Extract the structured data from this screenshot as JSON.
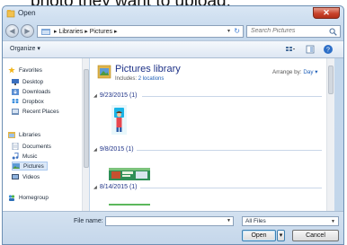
{
  "caption": {
    "text": "photo they want to upload."
  },
  "window": {
    "title": "Open",
    "close_glyph": "✕"
  },
  "address": {
    "back_glyph": "◀",
    "forward_glyph": "▶",
    "path": "▸ Libraries ▸ Pictures ▸",
    "dropdown_glyph": "▾",
    "refresh_glyph": "↻"
  },
  "search": {
    "placeholder": "Search Pictures"
  },
  "toolbar": {
    "organize_label": "Organize ▾"
  },
  "sidebar": {
    "favorites_label": "Favorites",
    "favorites": [
      {
        "label": "Desktop",
        "icon": "desktop-icon"
      },
      {
        "label": "Downloads",
        "icon": "downloads-icon"
      },
      {
        "label": "Dropbox",
        "icon": "dropbox-icon"
      },
      {
        "label": "Recent Places",
        "icon": "recent-places-icon"
      }
    ],
    "libraries_label": "Libraries",
    "libraries": [
      {
        "label": "Documents",
        "icon": "documents-icon"
      },
      {
        "label": "Music",
        "icon": "music-icon"
      },
      {
        "label": "Pictures",
        "icon": "pictures-icon",
        "selected": true
      },
      {
        "label": "Videos",
        "icon": "videos-icon"
      }
    ],
    "homegroup_label": "Homegroup"
  },
  "library": {
    "title": "Pictures library",
    "includes_label": "Includes:",
    "includes_value": "2 locations",
    "arrange_label": "Arrange by:",
    "arrange_value": "Day ▾"
  },
  "groups": [
    {
      "label": "9/23/2015 (1)"
    },
    {
      "label": "9/8/2015 (1)"
    },
    {
      "label": "8/14/2015 (1)"
    }
  ],
  "footer": {
    "filename_label": "File name:",
    "filename_value": "",
    "filetype_value": "All Files",
    "open_label": "Open",
    "split_glyph": "▾",
    "cancel_label": "Cancel"
  },
  "colors": {
    "link_blue": "#1e3287",
    "accent_blue": "#1e5fb8",
    "close_red": "#c9432b"
  }
}
